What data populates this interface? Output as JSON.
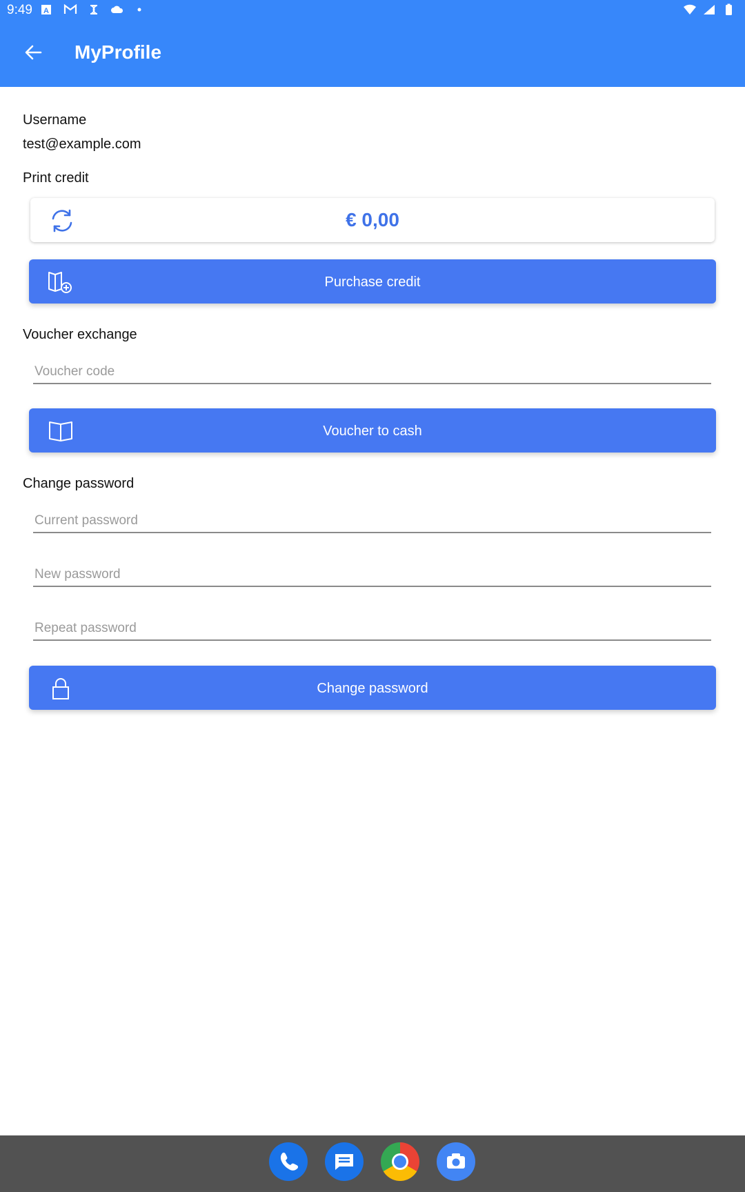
{
  "status_bar": {
    "time": "9:49",
    "left_icons": [
      "notification-a-icon",
      "gmail-icon",
      "sync-icon",
      "cloud-icon",
      "dot-icon"
    ],
    "right_icons": [
      "wifi-icon",
      "signal-icon",
      "battery-icon"
    ]
  },
  "app_bar": {
    "title": "MyProfile",
    "color": "#3787fa"
  },
  "profile": {
    "username_label": "Username",
    "username_value": "test@example.com",
    "print_credit_label": "Print credit",
    "credit_amount": "€ 0,00",
    "purchase_button": "Purchase credit",
    "voucher_section_label": "Voucher exchange",
    "voucher_placeholder": "Voucher code",
    "voucher_button": "Voucher to cash",
    "password_section_label": "Change password",
    "current_password_placeholder": "Current password",
    "new_password_placeholder": "New password",
    "repeat_password_placeholder": "Repeat password",
    "change_password_button": "Change password",
    "accent_color": "#4678f2"
  },
  "dock": {
    "apps": [
      "phone-icon",
      "messages-icon",
      "chrome-icon",
      "camera-icon"
    ]
  }
}
